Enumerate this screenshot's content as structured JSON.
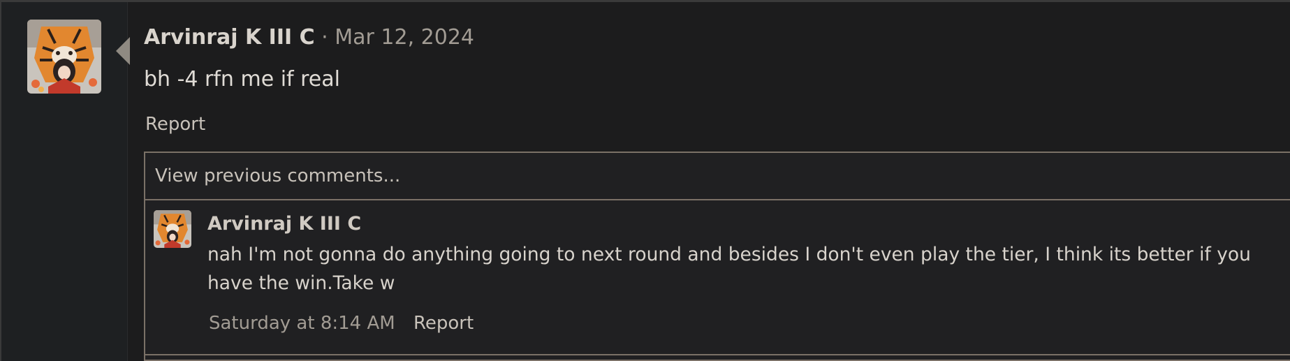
{
  "post": {
    "author": "Arvinraj K III C",
    "separator": "·",
    "date": "Mar 12, 2024",
    "body": "bh -4 rfn me if real",
    "report_label": "Report"
  },
  "comments": {
    "view_previous_label": "View previous comments...",
    "items": [
      {
        "author": "Arvinraj K III C",
        "text": "nah I'm not gonna do anything going to next round and besides I don't even play the tier, I think its better if you have the win.Take w",
        "time": "Saturday at 8:14 AM",
        "report_label": "Report"
      }
    ]
  },
  "colors": {
    "background": "#1c1c1d",
    "sidebar": "#1e2022",
    "border": "#7b7167",
    "text_primary": "#e0dcd6",
    "text_muted": "#a29c94"
  },
  "icons": {
    "avatar": "tiger-portrait-avatar",
    "pointer": "caret-left-icon"
  }
}
